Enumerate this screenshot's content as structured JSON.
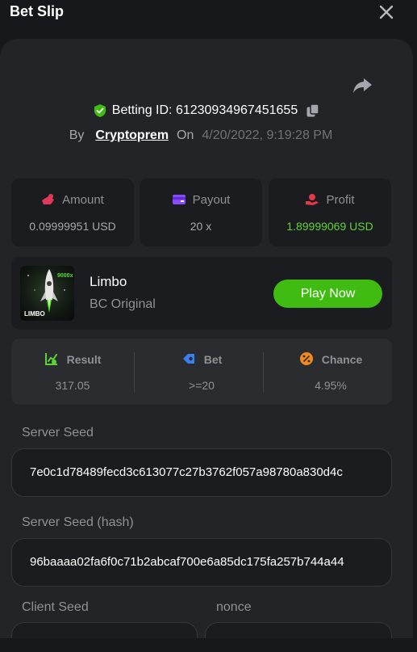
{
  "header": {
    "title": "Bet Slip"
  },
  "bet": {
    "id_label": "Betting ID:",
    "id": "61230934967451655",
    "by_label": "By",
    "user": "Cryptoprem",
    "on_label": "On",
    "datetime": "4/20/2022, 9:19:28 PM"
  },
  "stats": {
    "amount": {
      "label": "Amount",
      "value": "0.09999951 USD"
    },
    "payout": {
      "label": "Payout",
      "value": "20 x"
    },
    "profit": {
      "label": "Profit",
      "value": "1.89999069 USD"
    }
  },
  "game": {
    "name": "Limbo",
    "subtitle": "BC Original",
    "play_label": "Play Now",
    "thumb_text": "LIMBO",
    "thumb_badge": "9000x"
  },
  "result": {
    "result": {
      "label": "Result",
      "value": "317.05"
    },
    "bet": {
      "label": "Bet",
      "value": ">=20"
    },
    "chance": {
      "label": "Chance",
      "value": "4.95%"
    }
  },
  "seeds": {
    "server_seed": {
      "label": "Server Seed",
      "value": "7e0c1d78489fecd3c613077c27b3762f057a98780a830d4c"
    },
    "server_seed_hash": {
      "label": "Server Seed (hash)",
      "value": "96baaaa02fa6f0c71b2abcaf700e6a85dc175fa257b744a44"
    },
    "client_seed": {
      "label": "Client Seed"
    },
    "nonce": {
      "label": "nonce"
    }
  },
  "colors": {
    "accent_green": "#3fbb11",
    "profit_green": "#5fd233",
    "amount_icon": "#e2385e",
    "payout_icon": "#8a4bff",
    "profit_icon": "#e23a4a",
    "result_icon": "#5fd233",
    "bet_icon": "#3b7ff0",
    "chance_icon": "#f08a24"
  }
}
